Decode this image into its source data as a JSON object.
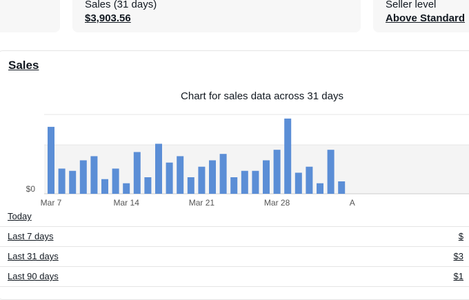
{
  "summary": {
    "sales_label": "Sales (31 days)",
    "sales_value": "$3,903.56",
    "seller_label": "Seller level",
    "seller_value": "Above Standard"
  },
  "sales_section": {
    "title": "Sales",
    "chart_title": "Chart for sales data across 31 days"
  },
  "periods": [
    {
      "label": "Today",
      "value": ""
    },
    {
      "label": "Last 7 days",
      "value": "$"
    },
    {
      "label": "Last 31 days",
      "value": "$3"
    },
    {
      "label": "Last 90 days",
      "value": "$1"
    }
  ],
  "colors": {
    "bar": "#5b8ed6",
    "grid": "#e5e5e5",
    "band": "#f4f4f4"
  },
  "chart_data": {
    "type": "bar",
    "title": "Chart for sales data across 31 days",
    "x_tick_labels": [
      "Mar 7",
      "Mar 14",
      "Mar 21",
      "Mar 28",
      "A"
    ],
    "y_tick_labels": [
      "$0"
    ],
    "categories": [
      "Mar 7",
      "Mar 8",
      "Mar 9",
      "Mar 10",
      "Mar 11",
      "Mar 12",
      "Mar 13",
      "Mar 14",
      "Mar 15",
      "Mar 16",
      "Mar 17",
      "Mar 18",
      "Mar 19",
      "Mar 20",
      "Mar 21",
      "Mar 22",
      "Mar 23",
      "Mar 24",
      "Mar 25",
      "Mar 26",
      "Mar 27",
      "Mar 28",
      "Mar 29",
      "Mar 30",
      "Mar 31",
      "Apr 1",
      "Apr 2",
      "Apr 3"
    ],
    "values": [
      178,
      67,
      61,
      89,
      100,
      39,
      67,
      28,
      111,
      44,
      133,
      83,
      100,
      44,
      72,
      89,
      106,
      44,
      61,
      61,
      89,
      117,
      200,
      56,
      72,
      28,
      117,
      33
    ],
    "ylim": [
      0,
      220
    ]
  }
}
